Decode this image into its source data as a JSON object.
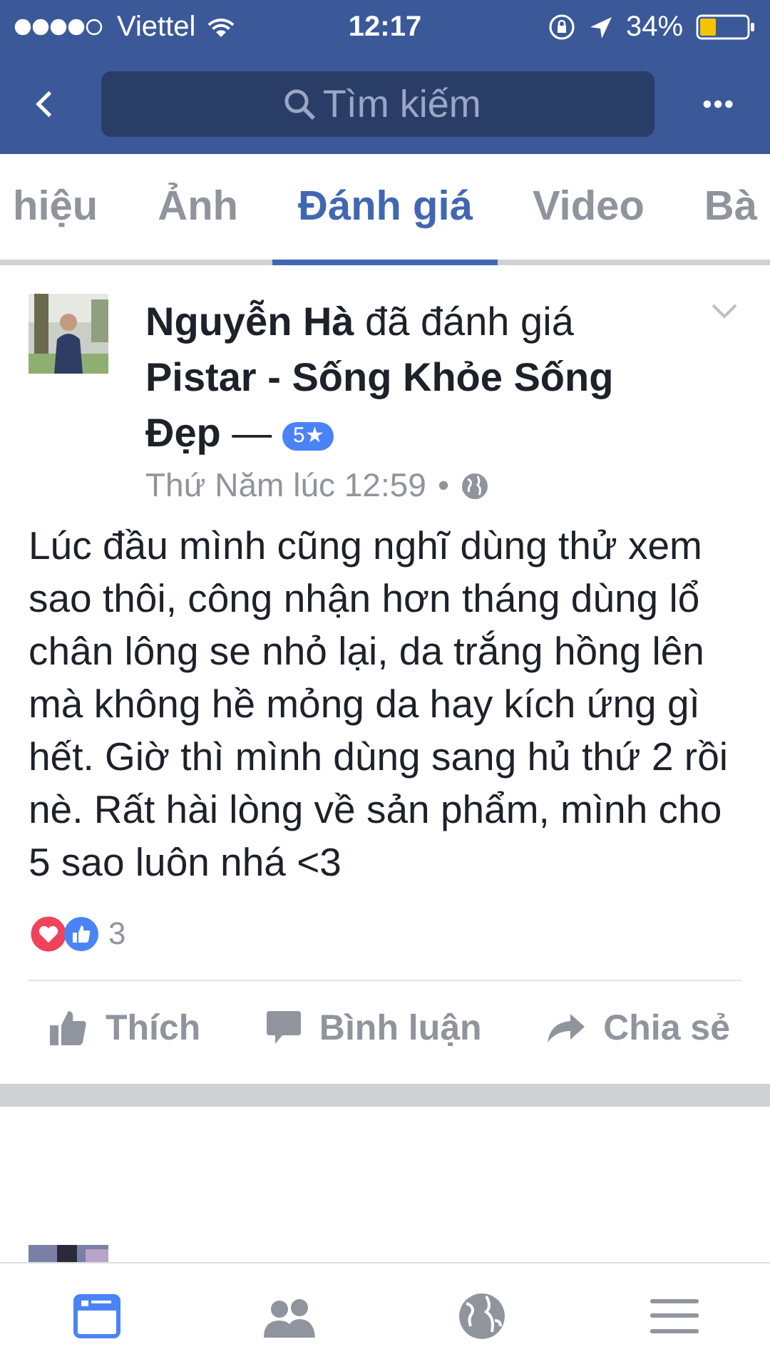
{
  "status_bar": {
    "carrier": "Viettel",
    "time": "12:17",
    "battery": "34%"
  },
  "nav_bar": {
    "search": {
      "placeholder": "Tìm kiếm"
    }
  },
  "tabs": [
    {
      "label": "hiệu",
      "selected": false
    },
    {
      "label": "Ảnh",
      "selected": false
    },
    {
      "label": "Đánh giá",
      "selected": true
    },
    {
      "label": "Video",
      "selected": false
    },
    {
      "label": "Bà",
      "selected": false
    }
  ],
  "review": {
    "headline": "**Nguyễn Hà** đã đánh giá **Pistar - Sống Khỏe Sống Đẹp** —",
    "rating": "5★",
    "timestamp": "Thứ Năm lúc 12:59",
    "separator": "•",
    "body": "Lúc đầu mình cũng nghĩ dùng thử xem sao thôi, công nhận hơn tháng dùng lổ chân lông se nhỏ lại, da trắng hồng lên mà không hề mỏng da hay kích ứng gì hết. Giờ thì mình dùng sang hủ thứ 2 rồi nè. Rất hài lòng về sản phẩm, mình cho 5 sao luôn nhá <3",
    "reaction_count": "3",
    "actions": [
      {
        "kind": "like",
        "label": "Thích"
      },
      {
        "kind": "comment",
        "label": "Bình luận"
      },
      {
        "kind": "share",
        "label": "Chia sẻ"
      }
    ]
  },
  "bottom_tabs": [
    {
      "kind": "feed",
      "selected": true
    },
    {
      "kind": "friends",
      "selected": false
    },
    {
      "kind": "globe",
      "selected": false
    },
    {
      "kind": "menu",
      "selected": false
    }
  ]
}
